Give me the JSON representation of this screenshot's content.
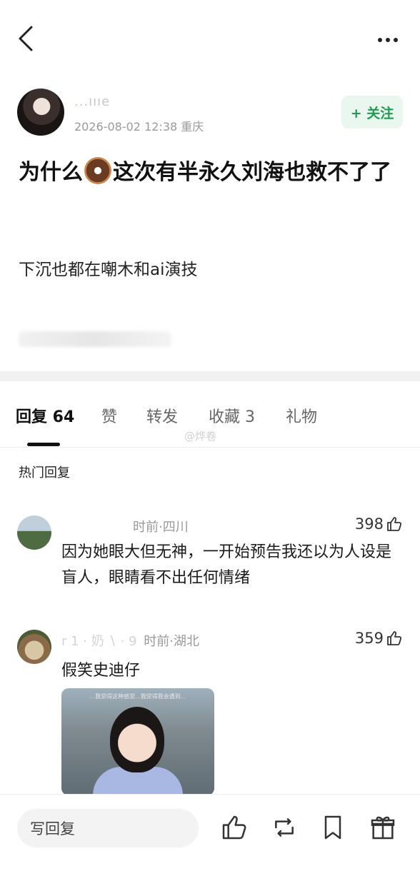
{
  "topbar": {
    "back_icon": "chevron-left-icon",
    "more_icon": "more-dots-icon"
  },
  "author": {
    "name": "...ıııe",
    "meta": "2026-08-02 12:38  重庆",
    "follow_label": "+ 关注"
  },
  "post": {
    "title_part1": "为什么",
    "title_emoji": "donut-emoji",
    "title_part2": "这次有半永久刘海也救不了了",
    "body": "下沉也都在嘲木和ai演技",
    "blurred_line": "毛"
  },
  "tabs": [
    {
      "label": "回复 64"
    },
    {
      "label": "赞"
    },
    {
      "label": "转发"
    },
    {
      "label": "收藏 3"
    },
    {
      "label": "礼物"
    }
  ],
  "watermark": "@烨卷",
  "section_label": "热门回复",
  "comments": [
    {
      "name_blurred": "",
      "time_location": "时前·四川",
      "likes": "398",
      "text": "因为她眼大但无神，一开始预告我还以为人设是盲人，眼睛看不出任何情绪"
    },
    {
      "name_blurred": "r 1 · 奶 ∖ · 9",
      "time_location": "时前·湖北",
      "likes": "359",
      "text": "假笑史迪仔",
      "image_caption": "...我觉得这种感觉...我觉得我会遇到..."
    }
  ],
  "bottombar": {
    "reply_placeholder": "写回复",
    "icons": [
      "thumbs-up-icon",
      "repost-icon",
      "bookmark-icon",
      "gift-icon"
    ]
  },
  "colors": {
    "accent_green": "#1f9d55",
    "follow_bg": "#e9f7ee",
    "divider": "#f1f1f1"
  }
}
